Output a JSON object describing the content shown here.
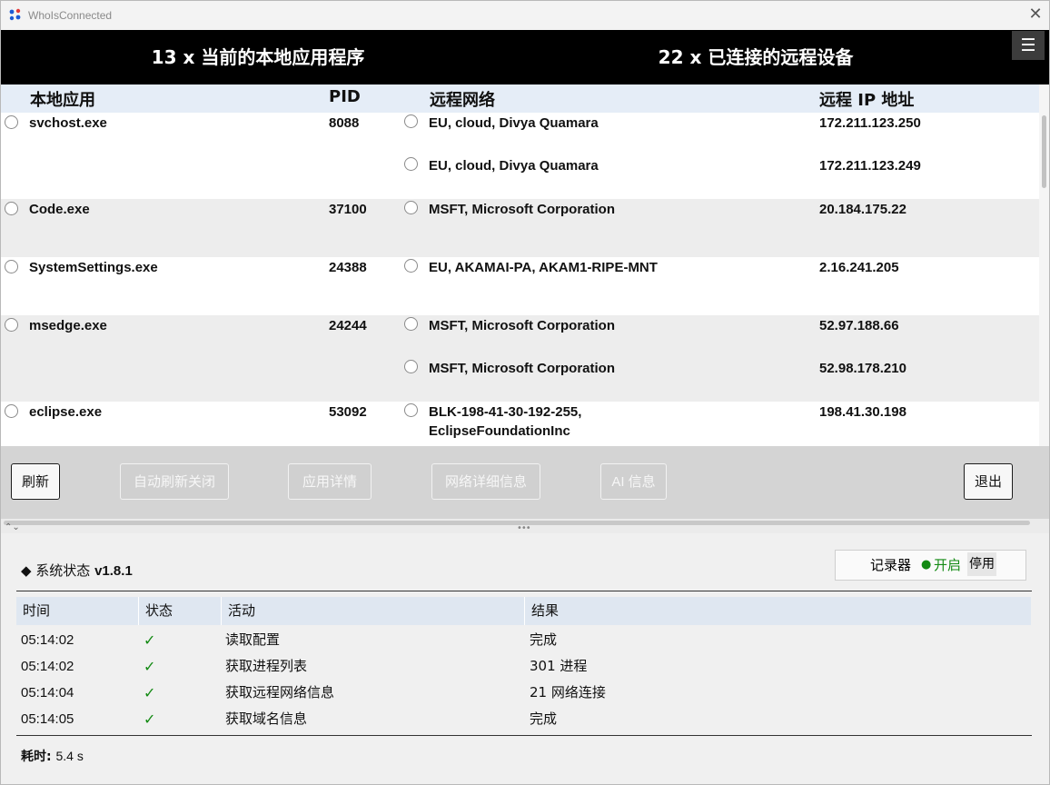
{
  "window": {
    "title": "WhoIsConnected"
  },
  "banner": {
    "local_count": "13 x 当前的本地应用程序",
    "remote_count": "22 x 已连接的远程设备",
    "menu_icon": "☰"
  },
  "table": {
    "headers": {
      "app": "本地应用",
      "pid": "PID",
      "network": "远程网络",
      "ip": "远程 IP 地址"
    },
    "rows": [
      {
        "app": "svchost.exe",
        "pid": "8088",
        "remotes": [
          {
            "network": "EU, cloud, Divya Quamara",
            "ip": "172.211.123.250"
          },
          {
            "network": "EU, cloud, Divya Quamara",
            "ip": "172.211.123.249"
          }
        ]
      },
      {
        "app": "Code.exe",
        "pid": "37100",
        "remotes": [
          {
            "network": "MSFT, Microsoft Corporation",
            "ip": "20.184.175.22"
          }
        ]
      },
      {
        "app": "SystemSettings.exe",
        "pid": "24388",
        "remotes": [
          {
            "network": "EU, AKAMAI-PA, AKAM1-RIPE-MNT",
            "ip": "2.16.241.205"
          }
        ]
      },
      {
        "app": "msedge.exe",
        "pid": "24244",
        "remotes": [
          {
            "network": "MSFT, Microsoft Corporation",
            "ip": "52.97.188.66"
          },
          {
            "network": "MSFT, Microsoft Corporation",
            "ip": "52.98.178.210"
          }
        ]
      },
      {
        "app": "eclipse.exe",
        "pid": "53092",
        "remotes": [
          {
            "network": "BLK-198-41-30-192-255,",
            "network_line2": "EclipseFoundationInc",
            "ip": "198.41.30.198"
          }
        ]
      }
    ]
  },
  "buttons": {
    "refresh": "刷新",
    "auto_refresh": "自动刷新关闭",
    "app_details": "应用详情",
    "net_details": "网络详细信息",
    "ai_info": "AI 信息",
    "exit": "退出"
  },
  "status": {
    "title_prefix": "◆ 系统状态 ",
    "version": "v1.8.1",
    "logger": {
      "label": "记录器",
      "dot": "●",
      "on": "开启",
      "off": "停用"
    },
    "headers": {
      "time": "时间",
      "state": "状态",
      "activity": "活动",
      "result": "结果"
    },
    "rows": [
      {
        "time": "05:14:02",
        "state": "✓",
        "activity": "读取配置",
        "result": "完成"
      },
      {
        "time": "05:14:02",
        "state": "✓",
        "activity": "获取进程列表",
        "result": "301 进程"
      },
      {
        "time": "05:14:04",
        "state": "✓",
        "activity": "获取远程网络信息",
        "result": "21 网络连接"
      },
      {
        "time": "05:14:05",
        "state": "✓",
        "activity": "获取域名信息",
        "result": "完成"
      }
    ],
    "elapsed_label": "耗时: ",
    "elapsed_value": "5.4 s"
  },
  "colors": {
    "banner_bg": "#000000",
    "header_bg": "#e5edf7",
    "check": "#138a13",
    "logger_on": "#138a13"
  }
}
